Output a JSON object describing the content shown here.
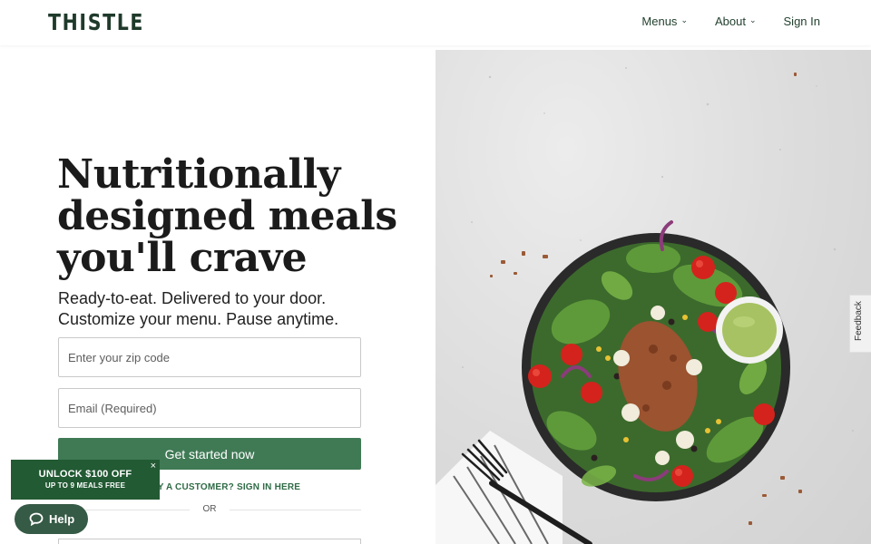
{
  "brand": {
    "logo": "THISTLE"
  },
  "nav": {
    "menus": "Menus",
    "about": "About",
    "sign_in": "Sign In"
  },
  "hero": {
    "title_lines": [
      "Nutritionally",
      "designed meals",
      "you'll crave"
    ],
    "subtitle_lines": [
      "Ready-to-eat. Delivered to your door.",
      "Customize your menu. Pause anytime."
    ]
  },
  "form": {
    "zip_placeholder": "Enter your zip code",
    "email_placeholder": "Email (Required)",
    "cta_label": "Get started now",
    "signin_link": "ALREADY A CUSTOMER? SIGN IN HERE",
    "or_text": "OR"
  },
  "promo": {
    "line1": "UNLOCK $100 OFF",
    "line2": "UP TO 9 MEALS FREE",
    "close": "×"
  },
  "help": {
    "label": "Help"
  },
  "feedback": {
    "label": "Feedback"
  },
  "colors": {
    "brand_green": "#1f3a2b",
    "cta_green": "#3f7a55",
    "promo_green": "#225a33",
    "help_green": "#355a45"
  }
}
